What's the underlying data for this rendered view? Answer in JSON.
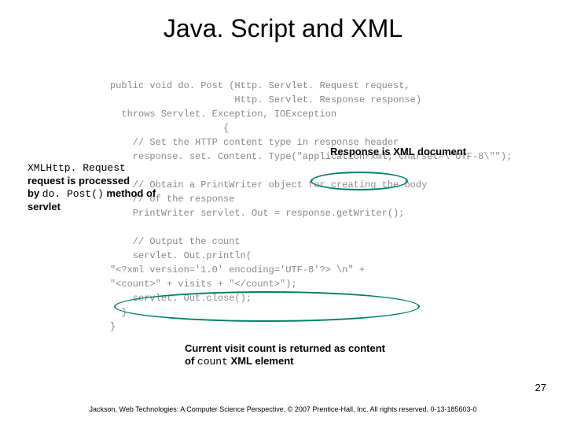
{
  "title": "Java. Script and XML",
  "code": "public void do. Post (Http. Servlet. Request request,\n                      Http. Servlet. Response response)\n  throws Servlet. Exception, IOException\n                    {\n    // Set the HTTP content type in response header\n    response. set. Content. Type(\"application/xml; charset=\\\"UTF-8\\\"\");\n\n    // Obtain a PrintWriter object for creating the body\n    // of the response\n    PrintWriter servlet. Out = response.getWriter();\n\n    // Output the count\n    servlet. Out.println(\n\"<?xml version='1.0' encoding='UTF-8'?> \\n\" +\n\"<count>\" + visits + \"</count>\");\n    servlet. Out.close();\n  }\n}",
  "callout_left_pre": "XMLHttp. Request",
  "callout_left_line2": "request is processed",
  "callout_left_line3_pre": "by ",
  "callout_left_mono": "do. Post()",
  "callout_left_line3_post": " method of",
  "callout_left_line4": "servlet",
  "callout_top_right": "Response is XML document",
  "callout_bottom_line1": "Current visit count is returned as content",
  "callout_bottom_line2_pre": "of ",
  "callout_bottom_mono": "count",
  "callout_bottom_line2_post": " XML element",
  "page_number": "27",
  "footer": "Jackson, Web Technologies: A Computer Science Perspective, © 2007 Prentice-Hall, Inc. All rights reserved. 0-13-185603-0"
}
